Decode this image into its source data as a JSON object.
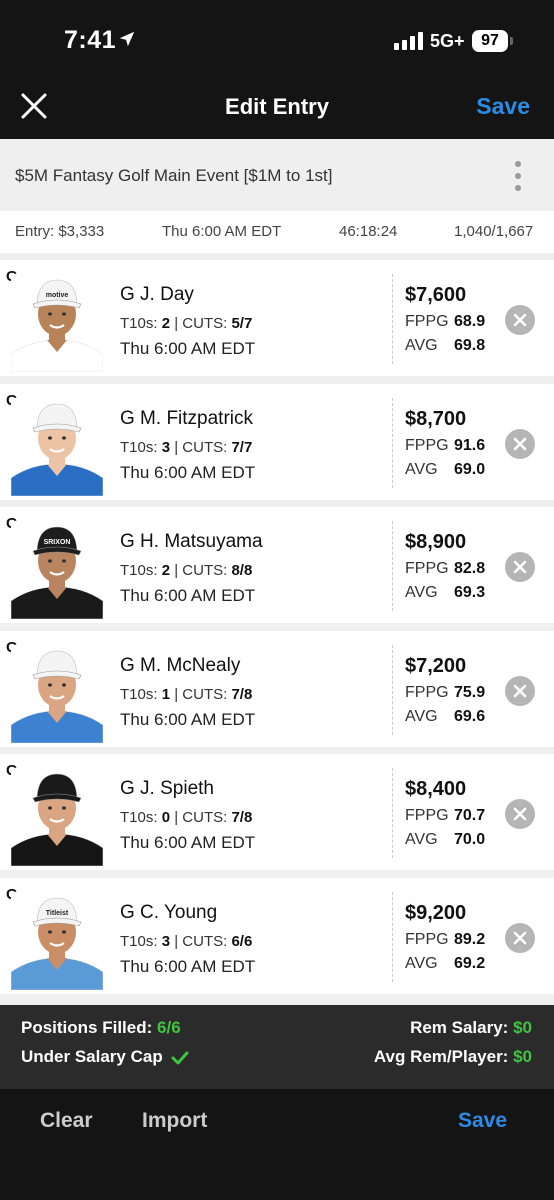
{
  "status_bar": {
    "time": "7:41",
    "network": "5G+",
    "battery": "97"
  },
  "nav": {
    "title": "Edit Entry",
    "save_label": "Save",
    "close_icon": "close-icon"
  },
  "contest": {
    "name": "$5M Fantasy Golf Main Event [$1M to 1st]",
    "entry": "Entry: $3,333",
    "start": "Thu 6:00 AM EDT",
    "countdown": "46:18:24",
    "entries": "1,040/1,667"
  },
  "labels": {
    "t10s": "T10s:",
    "cuts": "CUTS:",
    "fppg": "FPPG",
    "avg": "AVG",
    "sep": "|"
  },
  "players": [
    {
      "pos": "G",
      "name": "G  J. Day",
      "t10s": "2",
      "cuts": "5/7",
      "time": "Thu 6:00 AM EDT",
      "salary": "$7,600",
      "fppg": "68.9",
      "avg": "69.8",
      "hat": "#f4f4f4",
      "shirt": "#ffffff",
      "hat_text": "motive",
      "skin": "#b9835a"
    },
    {
      "pos": "G",
      "name": "G  M. Fitzpatrick",
      "t10s": "3",
      "cuts": "7/7",
      "time": "Thu 6:00 AM EDT",
      "salary": "$8,700",
      "fppg": "91.6",
      "avg": "69.0",
      "hat": "#f4f4f4",
      "shirt": "#2a6fc4",
      "hat_text": "",
      "skin": "#edc3a6"
    },
    {
      "pos": "G",
      "name": "G  H. Matsuyama",
      "t10s": "2",
      "cuts": "8/8",
      "time": "Thu 6:00 AM EDT",
      "salary": "$8,900",
      "fppg": "82.8",
      "avg": "69.3",
      "hat": "#1d1d1d",
      "shirt": "#1a1a1a",
      "hat_text": "SRIXON",
      "skin": "#b98460"
    },
    {
      "pos": "G",
      "name": "G  M. McNealy",
      "t10s": "1",
      "cuts": "7/8",
      "time": "Thu 6:00 AM EDT",
      "salary": "$7,200",
      "fppg": "75.9",
      "avg": "69.6",
      "hat": "#f4f4f4",
      "shirt": "#3d82d0",
      "hat_text": "",
      "skin": "#d9a582"
    },
    {
      "pos": "G",
      "name": "G  J. Spieth",
      "t10s": "0",
      "cuts": "7/8",
      "time": "Thu 6:00 AM EDT",
      "salary": "$8,400",
      "fppg": "70.7",
      "avg": "70.0",
      "hat": "#1a1a1a",
      "shirt": "#161616",
      "hat_text": "",
      "skin": "#d9a582"
    },
    {
      "pos": "G",
      "name": "G  C. Young",
      "t10s": "3",
      "cuts": "6/6",
      "time": "Thu 6:00 AM EDT",
      "salary": "$9,200",
      "fppg": "89.2",
      "avg": "69.2",
      "hat": "#f4f4f4",
      "shirt": "#5a9ad6",
      "hat_text": "Titleist",
      "skin": "#c98e66"
    }
  ],
  "summary": {
    "positions_label": "Positions Filled:",
    "positions_value": "6/6",
    "cap_label": "Under Salary Cap",
    "rem_salary_label": "Rem Salary:",
    "rem_salary_value": "$0",
    "avg_rem_label": "Avg Rem/Player:",
    "avg_rem_value": "$0"
  },
  "bottom": {
    "clear": "Clear",
    "import": "Import",
    "save": "Save"
  },
  "colors": {
    "accent": "#2b8ce6",
    "success": "#3fc43f",
    "dark": "#141414"
  }
}
